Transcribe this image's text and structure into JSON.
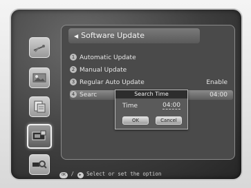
{
  "menu": {
    "title": "Software Update",
    "items": [
      {
        "number": "1",
        "label": "Automatic Update",
        "value": ""
      },
      {
        "number": "2",
        "label": "Manual Update",
        "value": ""
      },
      {
        "number": "3",
        "label": "Regular Auto Update",
        "value": "Enable"
      },
      {
        "number": "4",
        "label": "Searc",
        "value": "04:00"
      }
    ]
  },
  "dialog": {
    "title": "Search Time",
    "time_label": "Time",
    "time_value": "04:00",
    "ok_label": "OK",
    "cancel_label": "Cancel"
  },
  "footer": {
    "ok_key": "OK",
    "separator": " / ",
    "hint": "Select or set the option"
  },
  "sidebar": {
    "icons": [
      "satellite-dish-icon",
      "image-icon",
      "document-icon",
      "system-icon",
      "search-icon"
    ],
    "active_index": 3
  }
}
